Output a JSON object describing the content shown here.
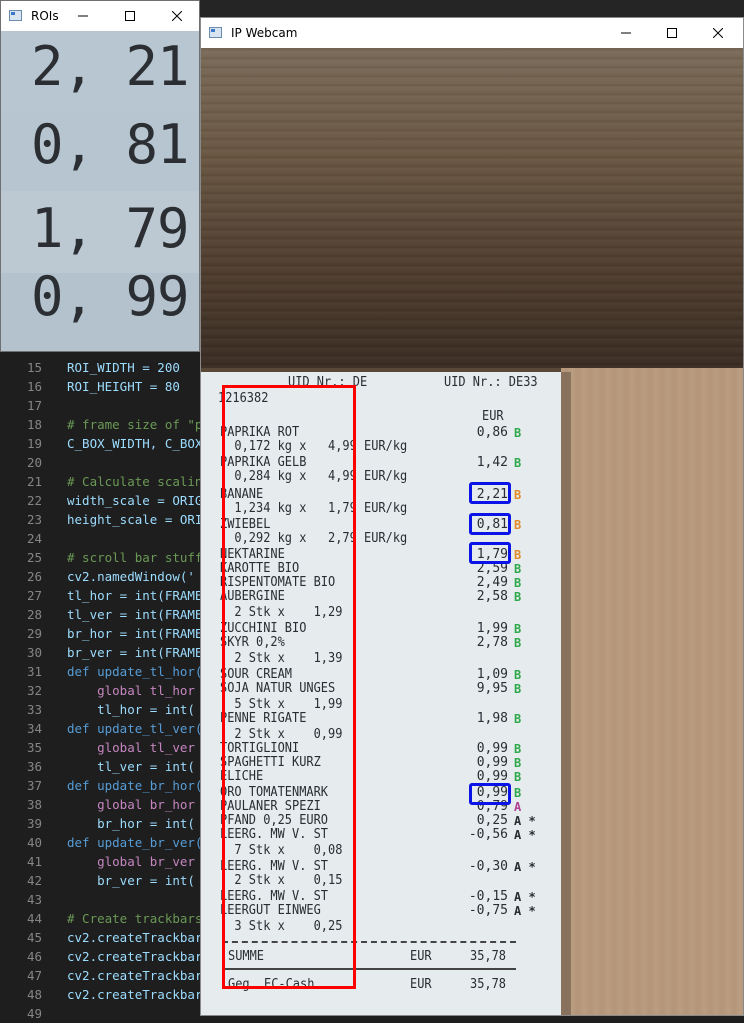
{
  "roi_window": {
    "title": "ROIs",
    "values": [
      "2, 21",
      "0, 81",
      "1, 79",
      "0, 99"
    ]
  },
  "cam_window": {
    "title": "IP Webcam"
  },
  "editor": {
    "lines": [
      {
        "n": "15",
        "text": "ROI_WIDTH = 200"
      },
      {
        "n": "16",
        "text": "ROI_HEIGHT = 80"
      },
      {
        "n": "17",
        "text": ""
      },
      {
        "n": "18",
        "text": "# frame size of \"p"
      },
      {
        "n": "19",
        "text": "C_BOX_WIDTH, C_BOX"
      },
      {
        "n": "20",
        "text": ""
      },
      {
        "n": "21",
        "text": "# Calculate scalin"
      },
      {
        "n": "22",
        "text": "width_scale = ORIG"
      },
      {
        "n": "23",
        "text": "height_scale = ORI"
      },
      {
        "n": "24",
        "text": ""
      },
      {
        "n": "25",
        "text": "# scroll bar stuff"
      },
      {
        "n": "26",
        "text": "cv2.namedWindow('"
      },
      {
        "n": "27",
        "text": "tl_hor = int(FRAME"
      },
      {
        "n": "28",
        "text": "tl_ver = int(FRAME"
      },
      {
        "n": "29",
        "text": "br_hor = int(FRAME"
      },
      {
        "n": "30",
        "text": "br_ver = int(FRAME"
      },
      {
        "n": "31",
        "text": "def update_tl_hor("
      },
      {
        "n": "32",
        "text": "    global tl_hor"
      },
      {
        "n": "33",
        "text": "    tl_hor = int("
      },
      {
        "n": "34",
        "text": "def update_tl_ver("
      },
      {
        "n": "35",
        "text": "    global tl_ver"
      },
      {
        "n": "36",
        "text": "    tl_ver = int("
      },
      {
        "n": "37",
        "text": "def update_br_hor("
      },
      {
        "n": "38",
        "text": "    global br_hor"
      },
      {
        "n": "39",
        "text": "    br_hor = int("
      },
      {
        "n": "40",
        "text": "def update_br_ver("
      },
      {
        "n": "41",
        "text": "    global br_ver"
      },
      {
        "n": "42",
        "text": "    br_ver = int("
      },
      {
        "n": "43",
        "text": ""
      },
      {
        "n": "44",
        "text": "# Create trackbars"
      },
      {
        "n": "45",
        "text": "cv2.createTrackbar"
      },
      {
        "n": "46",
        "text": "cv2.createTrackbar"
      },
      {
        "n": "47",
        "text": "cv2.createTrackbar"
      },
      {
        "n": "48",
        "text": "cv2.createTrackbar"
      },
      {
        "n": "49",
        "text": ""
      }
    ]
  },
  "receipt": {
    "header_left": "UID Nr.: DE",
    "header_right": "UID Nr.: DE33",
    "number": "1216382",
    "currency": "EUR",
    "lines": [
      {
        "text": "PAPRIKA ROT",
        "value": "0,86",
        "tax": "B"
      },
      {
        "text": "  0,172 kg x   4,99 EUR/kg",
        "value": "",
        "tax": ""
      },
      {
        "text": "PAPRIKA GELB",
        "value": "1,42",
        "tax": "B"
      },
      {
        "text": "  0,284 kg x   4,99 EUR/kg",
        "value": "",
        "tax": ""
      },
      {
        "text": "BANANE",
        "value": "2,21",
        "tax": "B"
      },
      {
        "text": "  1,234 kg x   1,79 EUR/kg",
        "value": "",
        "tax": ""
      },
      {
        "text": "ZWIEBEL",
        "value": "0,81",
        "tax": "B"
      },
      {
        "text": "  0,292 kg x   2,79 EUR/kg",
        "value": "",
        "tax": ""
      },
      {
        "text": "NEKTARINE",
        "value": "1,79",
        "tax": "B"
      },
      {
        "text": "KAROTTE BIO",
        "value": "2,59",
        "tax": "B"
      },
      {
        "text": "RISPENTOMATE BIO",
        "value": "2,49",
        "tax": "B"
      },
      {
        "text": "AUBERGINE",
        "value": "2,58",
        "tax": "B"
      },
      {
        "text": "  2 Stk x    1,29",
        "value": "",
        "tax": ""
      },
      {
        "text": "ZUCCHINI BIO",
        "value": "1,99",
        "tax": "B"
      },
      {
        "text": "SKYR 0,2%",
        "value": "2,78",
        "tax": "B"
      },
      {
        "text": "  2 Stk x    1,39",
        "value": "",
        "tax": ""
      },
      {
        "text": "SOUR CREAM",
        "value": "1,09",
        "tax": "B"
      },
      {
        "text": "SOJA NATUR UNGES",
        "value": "9,95",
        "tax": "B"
      },
      {
        "text": "  5 Stk x    1,99",
        "value": "",
        "tax": ""
      },
      {
        "text": "PENNE RIGATE",
        "value": "1,98",
        "tax": "B"
      },
      {
        "text": "  2 Stk x    0,99",
        "value": "",
        "tax": ""
      },
      {
        "text": "TORTIGLIONI",
        "value": "0,99",
        "tax": "B"
      },
      {
        "text": "SPAGHETTI KURZ",
        "value": "0,99",
        "tax": "B"
      },
      {
        "text": "ELICHE",
        "value": "0,99",
        "tax": "B"
      },
      {
        "text": "ORO TOMATENMARK",
        "value": "0,99",
        "tax": "B"
      },
      {
        "text": "PAULANER SPEZI",
        "value": "0,79",
        "tax": "A"
      },
      {
        "text": "PFAND 0,25 EURO",
        "value": "0,25",
        "tax": "A *"
      },
      {
        "text": "LEERG. MW V. ST",
        "value": "-0,56",
        "tax": "A *"
      },
      {
        "text": "  7 Stk x    0,08",
        "value": "",
        "tax": ""
      },
      {
        "text": "LEERG. MW V. ST",
        "value": "-0,30",
        "tax": "A *"
      },
      {
        "text": "  2 Stk x    0,15",
        "value": "",
        "tax": ""
      },
      {
        "text": "LEERG. MW V. ST",
        "value": "-0,15",
        "tax": "A *"
      },
      {
        "text": "LEERGUT EINWEG",
        "value": "-0,75",
        "tax": "A *"
      },
      {
        "text": "  3 Stk x    0,25",
        "value": "",
        "tax": ""
      }
    ],
    "total_label": "SUMME",
    "total_currency": "EUR",
    "total_value": "35,78",
    "payment_label": "Geg. EC-Cash",
    "payment_currency": "EUR",
    "payment_value": "35,78"
  }
}
